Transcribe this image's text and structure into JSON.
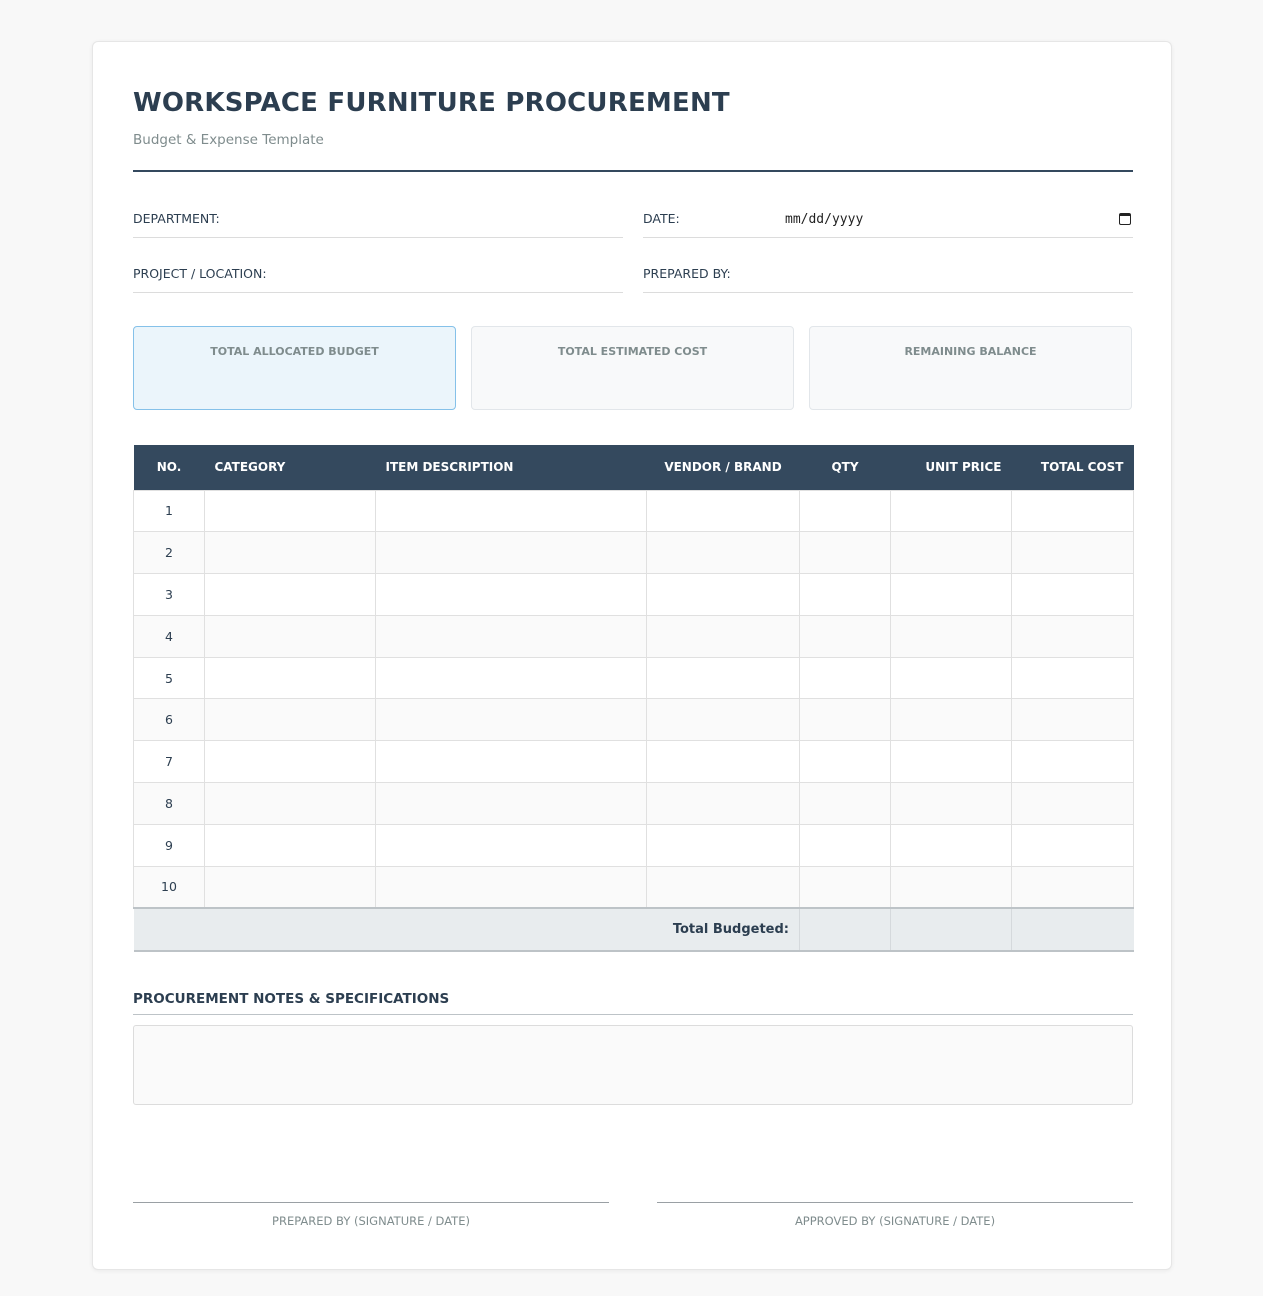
{
  "header": {
    "title": "WORKSPACE FURNITURE PROCUREMENT",
    "subtitle": "Budget & Expense Template"
  },
  "fields": {
    "department_label": "DEPARTMENT:",
    "date_label": "DATE:",
    "date_placeholder": "mm/dd/yyyy",
    "project_label": "PROJECT / LOCATION:",
    "prepared_by_label": "PREPARED BY:"
  },
  "summary": {
    "allocated_label": "TOTAL ALLOCATED BUDGET",
    "estimated_label": "TOTAL ESTIMATED COST",
    "remaining_label": "REMAINING BALANCE"
  },
  "table": {
    "headers": [
      "NO.",
      "CATEGORY",
      "ITEM DESCRIPTION",
      "VENDOR / BRAND",
      "QTY",
      "UNIT PRICE",
      "TOTAL COST"
    ],
    "rows": [
      "1",
      "2",
      "3",
      "4",
      "5",
      "6",
      "7",
      "8",
      "9",
      "10"
    ],
    "total_label": "Total Budgeted:"
  },
  "notes": {
    "title": "PROCUREMENT NOTES & SPECIFICATIONS"
  },
  "signatures": {
    "prepared": "PREPARED BY (SIGNATURE / DATE)",
    "approved": "APPROVED BY (SIGNATURE / DATE)"
  },
  "colors": {
    "header_bg": "#34495e",
    "title": "#2c3e50",
    "primary_card_bg": "#ebf5fb",
    "primary_card_border": "#85c1e9"
  },
  "icons": {
    "date_picker": "calendar-icon"
  }
}
